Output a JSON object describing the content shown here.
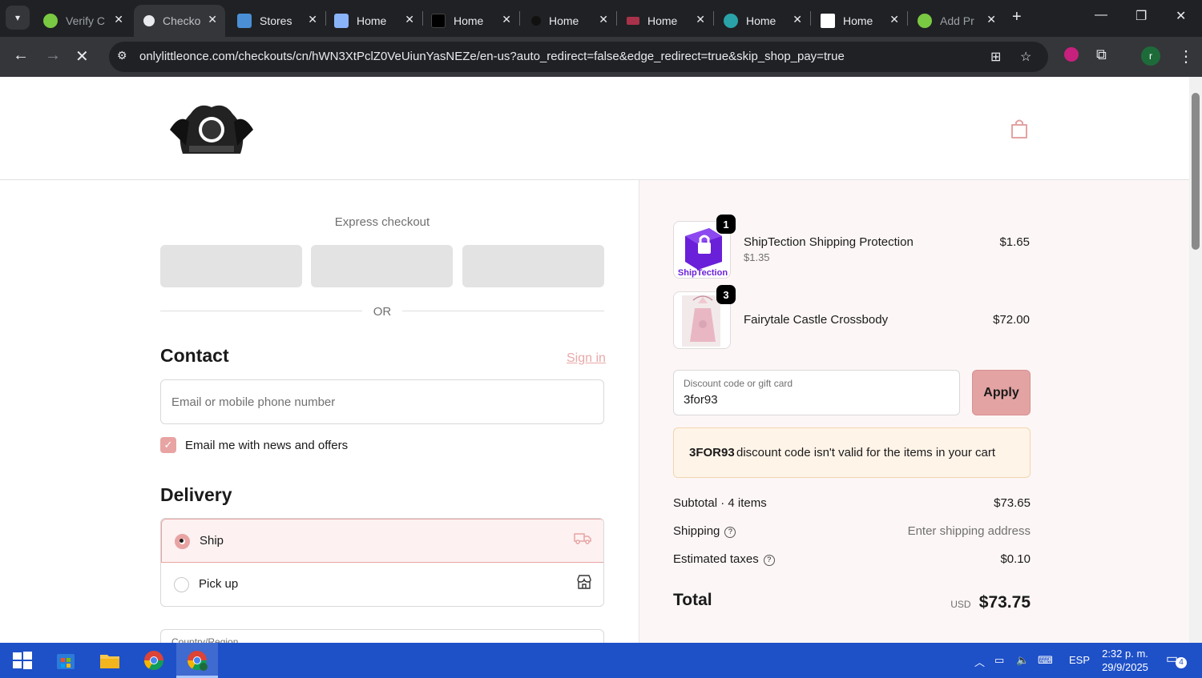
{
  "browser": {
    "tabs": [
      {
        "title": "Verify C",
        "active": false
      },
      {
        "title": "Checko",
        "active": true
      },
      {
        "title": "Stores",
        "active": false
      },
      {
        "title": "Home",
        "active": false
      },
      {
        "title": "Home",
        "active": false
      },
      {
        "title": "Home",
        "active": false
      },
      {
        "title": "Home",
        "active": false
      },
      {
        "title": "Home",
        "active": false
      },
      {
        "title": "Home",
        "active": false
      },
      {
        "title": "Add Pr",
        "active": false
      }
    ],
    "url": "onlylittleonce.com/checkouts/cn/hWN3XtPclZ0VeUiunYasNEZe/en-us?auto_redirect=false&edge_redirect=true&skip_shop_pay=true",
    "profile_initial": "r"
  },
  "checkout": {
    "express_title": "Express checkout",
    "or_text": "OR",
    "contact_title": "Contact",
    "sign_in": "Sign in",
    "email_placeholder": "Email or mobile phone number",
    "newsletter_label": "Email me with news and offers",
    "newsletter_checked": true,
    "delivery_title": "Delivery",
    "ship_label": "Ship",
    "pickup_label": "Pick up",
    "country_label": "Country/Region"
  },
  "summary": {
    "items": [
      {
        "name": "ShipTection Shipping Protection",
        "sub": "$1.35",
        "price": "$1.65",
        "qty": "1",
        "thumb_text": "ShipTection"
      },
      {
        "name": "Fairytale Castle Crossbody",
        "sub": "",
        "price": "$72.00",
        "qty": "3"
      }
    ],
    "discount_label": "Discount code or gift card",
    "discount_value": "3for93",
    "apply_label": "Apply",
    "error_code": "3FOR93",
    "error_message": "discount code isn't valid for the items in your cart",
    "subtotal_label": "Subtotal · 4 items",
    "subtotal_value": "$73.65",
    "shipping_label": "Shipping",
    "shipping_value": "Enter shipping address",
    "taxes_label": "Estimated taxes",
    "taxes_value": "$0.10",
    "total_label": "Total",
    "currency": "USD",
    "total_value": "$73.75"
  },
  "taskbar": {
    "lang": "ESP",
    "time": "2:32 p. m.",
    "date": "29/9/2025",
    "notifications": "4"
  },
  "colors": {
    "accent": "#e8a3a3",
    "taskbar": "#1e50c8"
  }
}
